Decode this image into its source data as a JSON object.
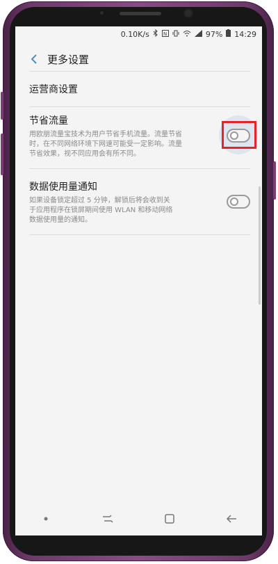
{
  "status_bar": {
    "speed": "0.10K/s",
    "battery": "97%",
    "time": "14:29",
    "icons": [
      "bluetooth-icon",
      "nfc-icon",
      "vibrate-icon",
      "wifi-icon",
      "signal-icon",
      "battery-icon"
    ]
  },
  "header": {
    "title": "更多设置",
    "back_icon": "chevron-left-icon"
  },
  "settings": {
    "carrier": {
      "title": "运营商设置"
    },
    "data_saver": {
      "title": "节省流量",
      "desc_lines": [
        "用欧朋流量宝技术为用户节省手机流量。流量节省",
        "时，在不同网络环境下网速可能受一定影响。流量",
        "节省效果，视不同应用会有所不同。"
      ],
      "enabled": false,
      "highlighted": true
    },
    "data_usage_notify": {
      "title": "数据使用量通知",
      "desc_lines": [
        "如果设备锁定超过 5 分钟，解锁后将会收到关",
        "于应用程序在锁屏期间使用 WLAN 和移动网络",
        "数据使用量的通知。"
      ],
      "enabled": false
    }
  },
  "nav_bar": {
    "icons": [
      "dot-icon",
      "recents-icon",
      "home-icon",
      "back-arrow-icon"
    ]
  },
  "colors": {
    "highlight": "#e3242b",
    "accent": "#4a90c2",
    "frame": "#8a4a86"
  }
}
